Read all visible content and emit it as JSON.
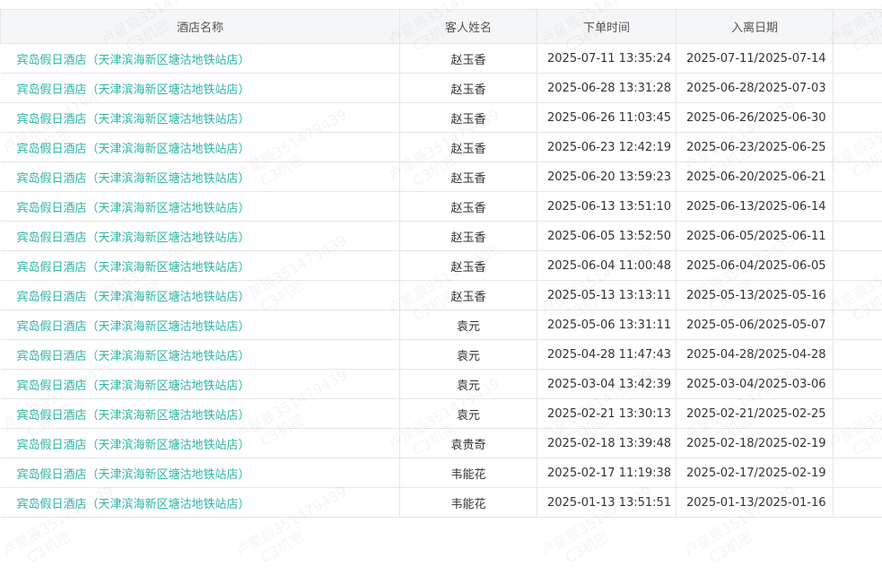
{
  "table": {
    "headers": [
      "酒店名称",
      "客人姓名",
      "下单时间",
      "入离日期"
    ],
    "rows": [
      {
        "hotel": "宾岛假日酒店（天津滨海新区塘沽地铁站店）",
        "guest": "赵玉香",
        "order_time": "2025-07-11 13:35:24",
        "stay": "2025-07-11/2025-07-14"
      },
      {
        "hotel": "宾岛假日酒店（天津滨海新区塘沽地铁站店）",
        "guest": "赵玉香",
        "order_time": "2025-06-28 13:31:28",
        "stay": "2025-06-28/2025-07-03"
      },
      {
        "hotel": "宾岛假日酒店（天津滨海新区塘沽地铁站店）",
        "guest": "赵玉香",
        "order_time": "2025-06-26 11:03:45",
        "stay": "2025-06-26/2025-06-30"
      },
      {
        "hotel": "宾岛假日酒店（天津滨海新区塘沽地铁站店）",
        "guest": "赵玉香",
        "order_time": "2025-06-23 12:42:19",
        "stay": "2025-06-23/2025-06-25"
      },
      {
        "hotel": "宾岛假日酒店（天津滨海新区塘沽地铁站店）",
        "guest": "赵玉香",
        "order_time": "2025-06-20 13:59:23",
        "stay": "2025-06-20/2025-06-21"
      },
      {
        "hotel": "宾岛假日酒店（天津滨海新区塘沽地铁站店）",
        "guest": "赵玉香",
        "order_time": "2025-06-13 13:51:10",
        "stay": "2025-06-13/2025-06-14"
      },
      {
        "hotel": "宾岛假日酒店（天津滨海新区塘沽地铁站店）",
        "guest": "赵玉香",
        "order_time": "2025-06-05 13:52:50",
        "stay": "2025-06-05/2025-06-11"
      },
      {
        "hotel": "宾岛假日酒店（天津滨海新区塘沽地铁站店）",
        "guest": "赵玉香",
        "order_time": "2025-06-04 11:00:48",
        "stay": "2025-06-04/2025-06-05"
      },
      {
        "hotel": "宾岛假日酒店（天津滨海新区塘沽地铁站店）",
        "guest": "赵玉香",
        "order_time": "2025-05-13 13:13:11",
        "stay": "2025-05-13/2025-05-16"
      },
      {
        "hotel": "宾岛假日酒店（天津滨海新区塘沽地铁站店）",
        "guest": "袁元",
        "order_time": "2025-05-06 13:31:11",
        "stay": "2025-05-06/2025-05-07"
      },
      {
        "hotel": "宾岛假日酒店（天津滨海新区塘沽地铁站店）",
        "guest": "袁元",
        "order_time": "2025-04-28 11:47:43",
        "stay": "2025-04-28/2025-04-28"
      },
      {
        "hotel": "宾岛假日酒店（天津滨海新区塘沽地铁站店）",
        "guest": "袁元",
        "order_time": "2025-03-04 13:42:39",
        "stay": "2025-03-04/2025-03-06"
      },
      {
        "hotel": "宾岛假日酒店（天津滨海新区塘沽地铁站店）",
        "guest": "袁元",
        "order_time": "2025-02-21 13:30:13",
        "stay": "2025-02-21/2025-02-25"
      },
      {
        "hotel": "宾岛假日酒店（天津滨海新区塘沽地铁站店）",
        "guest": "袁贵奇",
        "order_time": "2025-02-18 13:39:48",
        "stay": "2025-02-18/2025-02-19"
      },
      {
        "hotel": "宾岛假日酒店（天津滨海新区塘沽地铁站店）",
        "guest": "韦能花",
        "order_time": "2025-02-17 11:19:38",
        "stay": "2025-02-17/2025-02-19"
      },
      {
        "hotel": "宾岛假日酒店（天津滨海新区塘沽地铁站店）",
        "guest": "韦能花",
        "order_time": "2025-01-13 13:51:51",
        "stay": "2025-01-13/2025-01-16"
      }
    ]
  },
  "watermark": {
    "line1": "卢星辰351479439",
    "line2": "C3机密"
  },
  "colors": {
    "link": "#2fb5a5",
    "header_bg": "#f5f6f8",
    "border": "#e6e6e6"
  }
}
